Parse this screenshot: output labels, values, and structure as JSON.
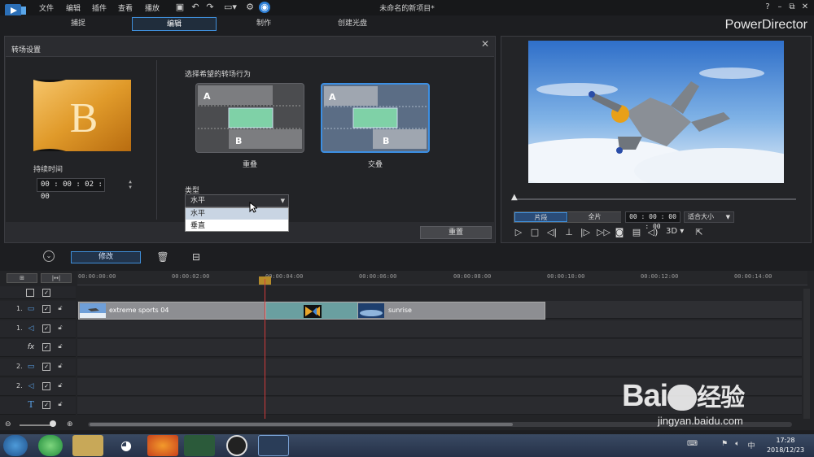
{
  "app": {
    "doc_title": "未命名的新项目*",
    "brand": "PowerDirector",
    "menu": [
      "文件",
      "编辑",
      "插件",
      "查看",
      "播放"
    ]
  },
  "modes": [
    "捕捉",
    "编辑",
    "制作",
    "创建光盘"
  ],
  "transition_panel": {
    "title": "转场设置",
    "thumb_letter": "B",
    "duration_label": "持续时间",
    "duration_value": "00 : 00 : 02 : 00",
    "choose_label": "选择希望的转场行为",
    "options": [
      {
        "label": "重叠",
        "a": "A",
        "b": "B"
      },
      {
        "label": "交叠",
        "a": "A",
        "b": "B"
      }
    ],
    "type_label": "类型",
    "type_value": "水平",
    "dropdown_options": [
      "水平",
      "垂直"
    ],
    "reset_label": "重置"
  },
  "preview": {
    "tab_clip": "片段",
    "tab_full": "全片",
    "timecode": "00 : 00 : 00 : 00",
    "fit_label": "适合大小",
    "three_d": "3D"
  },
  "timeline_toolbar": {
    "modify_label": "修改"
  },
  "ruler_labels": [
    "00:00:00:00",
    "00:00:02:00",
    "00:00:04:00",
    "00:00:06:00",
    "00:00:08:00",
    "00:00:10:00",
    "00:00:12:00",
    "00:00:14:00"
  ],
  "tracks": [
    {
      "num": "1.",
      "icon": "▭"
    },
    {
      "num": "1.",
      "icon": "◁"
    },
    {
      "num": "",
      "icon": "fx"
    },
    {
      "num": "2.",
      "icon": "▭"
    },
    {
      "num": "2.",
      "icon": "◁"
    },
    {
      "num": "",
      "icon": "T"
    }
  ],
  "clips": {
    "clip1": "extreme sports 04",
    "clip2": "sunrise"
  },
  "taskbar": {
    "time": "17:28",
    "date": "2018/12/23"
  },
  "watermark": {
    "line1": "Bai",
    "line2": "经验",
    "url": "jingyan.baidu.com"
  }
}
